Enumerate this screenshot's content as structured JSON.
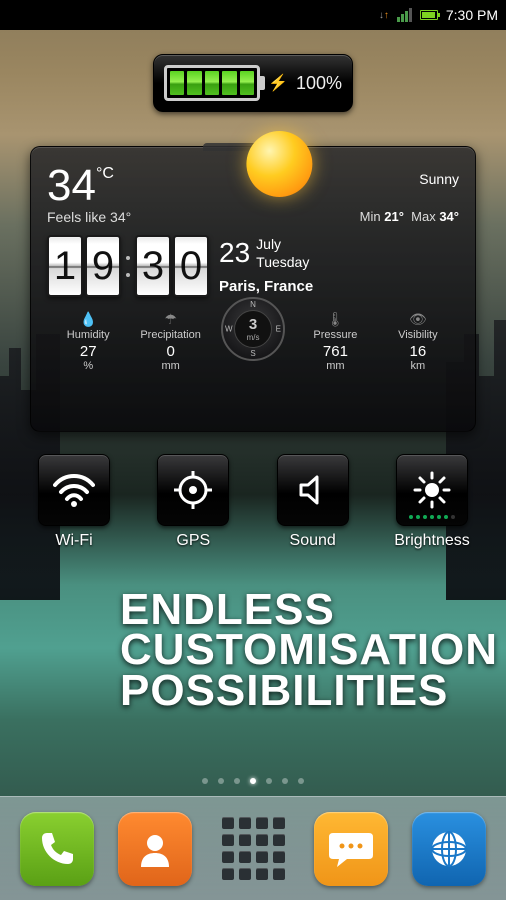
{
  "status": {
    "time": "7:30 PM"
  },
  "battery_widget": {
    "percent": "100%"
  },
  "weather": {
    "temp": "34",
    "temp_unit": "°C",
    "feels_label": "Feels like",
    "feels": "34°",
    "condition": "Sunny",
    "min_label": "Min",
    "min": "21°",
    "max_label": "Max",
    "max": "34°",
    "clock": {
      "h1": "1",
      "h2": "9",
      "m1": "3",
      "m2": "0"
    },
    "date": {
      "day": "23",
      "month": "July",
      "weekday": "Tuesday"
    },
    "location": "Paris, France",
    "meters": {
      "humidity": {
        "label": "Humidity",
        "value": "27",
        "unit": "%"
      },
      "precip": {
        "label": "Precipitation",
        "value": "0",
        "unit": "mm"
      },
      "wind": {
        "value": "3",
        "unit": "m/s"
      },
      "pressure": {
        "label": "Pressure",
        "value": "761",
        "unit": "mm"
      },
      "visibility": {
        "label": "Visibility",
        "value": "16",
        "unit": "km"
      }
    }
  },
  "toggles": {
    "wifi": "Wi-Fi",
    "gps": "GPS",
    "sound": "Sound",
    "brightness": "Brightness"
  },
  "promo": {
    "l1": "ENDLESS",
    "l2": "CUSTOMISATION",
    "l3": "POSSIBILITIES"
  },
  "compass": {
    "n": "N",
    "s": "S",
    "e": "E",
    "w": "W"
  }
}
